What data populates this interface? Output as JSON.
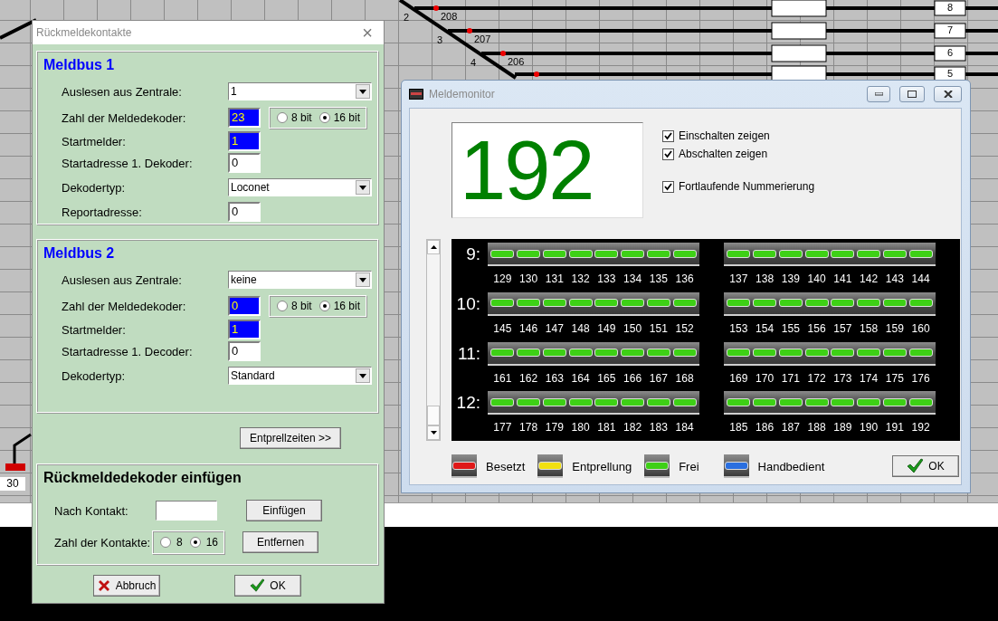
{
  "layout": {
    "track_numbers": [
      "2",
      "3",
      "4"
    ],
    "block_labels": [
      "208",
      "207",
      "206"
    ],
    "track_boxes": [
      "8",
      "7",
      "6",
      "5"
    ],
    "bumper_label": "30"
  },
  "feedback_dialog": {
    "title": "Rückmeldekontakte",
    "close": "×",
    "groups": [
      {
        "title": "Meldbus 1",
        "rows": [
          {
            "kind": "select",
            "label": "Auslesen aus Zentrale:",
            "value": "1"
          },
          {
            "kind": "count",
            "label": "Zahl der Meldedekoder:",
            "value": "23",
            "highlighted": true,
            "options": [
              {
                "label": "8 bit",
                "selected": false
              },
              {
                "label": "16 bit",
                "selected": true
              }
            ]
          },
          {
            "kind": "number",
            "label": "Startmelder:",
            "value": "1",
            "highlighted": true
          },
          {
            "kind": "number",
            "label": "Startadresse 1. Dekoder:",
            "value": "0",
            "highlighted": false
          },
          {
            "kind": "select",
            "label": "Dekodertyp:",
            "value": "Loconet"
          },
          {
            "kind": "number",
            "label": "Reportadresse:",
            "value": "0",
            "highlighted": false
          }
        ]
      },
      {
        "title": "Meldbus 2",
        "rows": [
          {
            "kind": "select",
            "label": "Auslesen aus Zentrale:",
            "value": "keine"
          },
          {
            "kind": "count",
            "label": "Zahl der Meldedekoder:",
            "value": "0",
            "highlighted": true,
            "options": [
              {
                "label": "8 bit",
                "selected": false
              },
              {
                "label": "16 bit",
                "selected": true
              }
            ]
          },
          {
            "kind": "number",
            "label": "Startmelder:",
            "value": "1",
            "highlighted": true
          },
          {
            "kind": "number",
            "label": "Startadresse 1. Decoder:",
            "value": "0",
            "highlighted": false
          },
          {
            "kind": "select",
            "label": "Dekodertyp:",
            "value": "Standard"
          }
        ]
      }
    ],
    "debounce_button": "Entprellzeiten >>",
    "insert_group": {
      "title": "Rückmeldedekoder einfügen",
      "after_contact_label": "Nach Kontakt:",
      "contact_count_label": "Zahl der Kontakte:",
      "contact_count_options": [
        {
          "label": "8",
          "selected": false
        },
        {
          "label": "16",
          "selected": true
        }
      ],
      "insert_button": "Einfügen",
      "remove_button": "Entfernen"
    },
    "cancel_button": "Abbruch",
    "ok_button": "OK"
  },
  "monitor": {
    "title": "Meldemonitor",
    "counter": "192",
    "checkboxes": [
      {
        "label": "Einschalten zeigen",
        "checked": true
      },
      {
        "label": "Abschalten zeigen",
        "checked": true
      },
      {
        "label": "Fortlaufende Nummerierung",
        "checked": true
      }
    ],
    "rows": [
      {
        "label": "9:",
        "contacts": [
          {
            "number": "129",
            "color": "#3ed016"
          },
          {
            "number": "130",
            "color": "#3ed016"
          },
          {
            "number": "131",
            "color": "#3ed016"
          },
          {
            "number": "132",
            "color": "#3ed016"
          },
          {
            "number": "133",
            "color": "#3ed016"
          },
          {
            "number": "134",
            "color": "#3ed016"
          },
          {
            "number": "135",
            "color": "#3ed016"
          },
          {
            "number": "136",
            "color": "#3ed016"
          },
          {
            "number": "137",
            "color": "#3ed016"
          },
          {
            "number": "138",
            "color": "#3ed016"
          },
          {
            "number": "139",
            "color": "#3ed016"
          },
          {
            "number": "140",
            "color": "#3ed016"
          },
          {
            "number": "141",
            "color": "#3ed016"
          },
          {
            "number": "142",
            "color": "#3ed016"
          },
          {
            "number": "143",
            "color": "#3ed016"
          },
          {
            "number": "144",
            "color": "#3ed016"
          }
        ]
      },
      {
        "label": "10:",
        "contacts": [
          {
            "number": "145",
            "color": "#3ed016"
          },
          {
            "number": "146",
            "color": "#3ed016"
          },
          {
            "number": "147",
            "color": "#3ed016"
          },
          {
            "number": "148",
            "color": "#3ed016"
          },
          {
            "number": "149",
            "color": "#3ed016"
          },
          {
            "number": "150",
            "color": "#3ed016"
          },
          {
            "number": "151",
            "color": "#3ed016"
          },
          {
            "number": "152",
            "color": "#3ed016"
          },
          {
            "number": "153",
            "color": "#3ed016"
          },
          {
            "number": "154",
            "color": "#3ed016"
          },
          {
            "number": "155",
            "color": "#3ed016"
          },
          {
            "number": "156",
            "color": "#3ed016"
          },
          {
            "number": "157",
            "color": "#3ed016"
          },
          {
            "number": "158",
            "color": "#3ed016"
          },
          {
            "number": "159",
            "color": "#3ed016"
          },
          {
            "number": "160",
            "color": "#3ed016"
          }
        ]
      },
      {
        "label": "11:",
        "contacts": [
          {
            "number": "161",
            "color": "#3ed016"
          },
          {
            "number": "162",
            "color": "#3ed016"
          },
          {
            "number": "163",
            "color": "#3ed016"
          },
          {
            "number": "164",
            "color": "#3ed016"
          },
          {
            "number": "165",
            "color": "#3ed016"
          },
          {
            "number": "166",
            "color": "#3ed016"
          },
          {
            "number": "167",
            "color": "#3ed016"
          },
          {
            "number": "168",
            "color": "#3ed016"
          },
          {
            "number": "169",
            "color": "#3ed016"
          },
          {
            "number": "170",
            "color": "#3ed016"
          },
          {
            "number": "171",
            "color": "#3ed016"
          },
          {
            "number": "172",
            "color": "#3ed016"
          },
          {
            "number": "173",
            "color": "#3ed016"
          },
          {
            "number": "174",
            "color": "#3ed016"
          },
          {
            "number": "175",
            "color": "#3ed016"
          },
          {
            "number": "176",
            "color": "#3ed016"
          }
        ]
      },
      {
        "label": "12:",
        "contacts": [
          {
            "number": "177",
            "color": "#3ed016"
          },
          {
            "number": "178",
            "color": "#3ed016"
          },
          {
            "number": "179",
            "color": "#3ed016"
          },
          {
            "number": "180",
            "color": "#3ed016"
          },
          {
            "number": "181",
            "color": "#3ed016"
          },
          {
            "number": "182",
            "color": "#3ed016"
          },
          {
            "number": "183",
            "color": "#3ed016"
          },
          {
            "number": "184",
            "color": "#3ed016"
          },
          {
            "number": "185",
            "color": "#3ed016"
          },
          {
            "number": "186",
            "color": "#3ed016"
          },
          {
            "number": "187",
            "color": "#3ed016"
          },
          {
            "number": "188",
            "color": "#3ed016"
          },
          {
            "number": "189",
            "color": "#3ed016"
          },
          {
            "number": "190",
            "color": "#3ed016"
          },
          {
            "number": "191",
            "color": "#3ed016"
          },
          {
            "number": "192",
            "color": "#3ed016"
          }
        ]
      }
    ],
    "legend": [
      {
        "label": "Besetzt",
        "color": "#e01818"
      },
      {
        "label": "Entprellung",
        "color": "#f2e010"
      },
      {
        "label": "Frei",
        "color": "#3ed016"
      },
      {
        "label": "Handbedient",
        "color": "#2a6fe0"
      }
    ],
    "ok_button": "OK"
  }
}
